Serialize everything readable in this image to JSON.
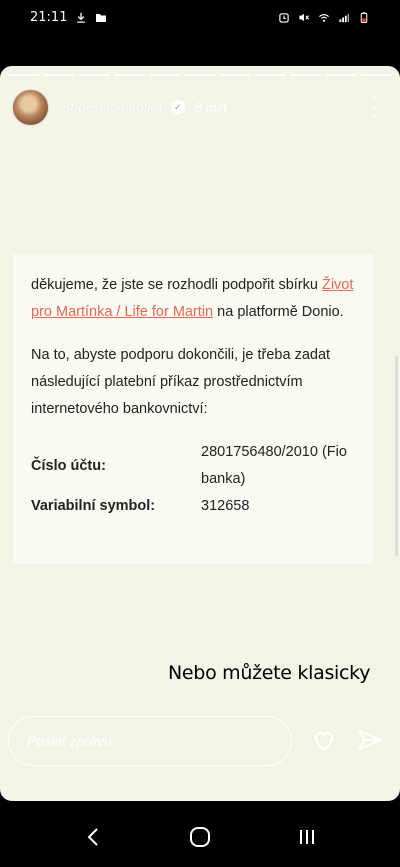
{
  "status_bar": {
    "time": "21:11",
    "left_icons": [
      "download-icon",
      "folder-icon"
    ],
    "right_icons": [
      "alarm-icon",
      "mute-icon",
      "wifi-icon",
      "signal-icon",
      "battery-icon"
    ]
  },
  "story": {
    "segments": 11,
    "username": "stibrovicnikolka",
    "time_ago": "8 min.",
    "email": {
      "intro_text": "děkujeme, že jste se rozhodli podpořit sbírku",
      "link_text": "Život pro Martínka / Life for Martin",
      "intro_suffix": "na platformě Donio.",
      "para2": "Na to, abyste podporu dokončili, je třeba zadat následující platební příkaz prostřednictvím internetového bankovnictví:",
      "account_label": "Číslo účtu:",
      "account_value": "2801756480/2010 (Fio banka)",
      "vs_label": "Variabilní symbol:",
      "vs_value": "312658"
    },
    "caption": "Nebo můžete klasicky"
  },
  "reply": {
    "placeholder": "Poslat zprávu"
  },
  "colors": {
    "story_bg": "#f4f4e6",
    "link": "#e06b54"
  }
}
